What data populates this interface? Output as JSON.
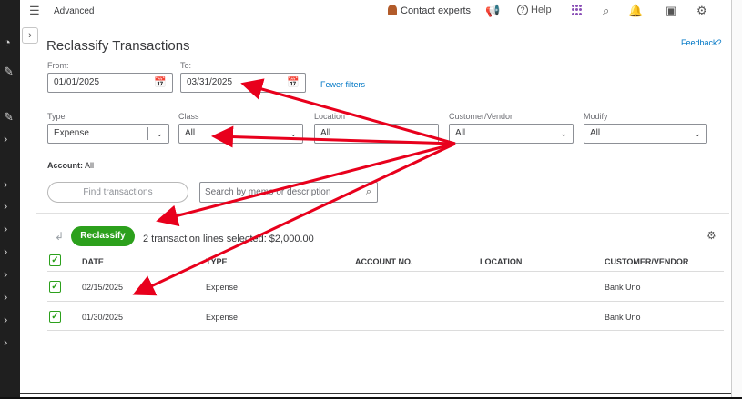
{
  "topbar": {
    "breadcrumb": "Advanced",
    "contact_label": "Contact experts",
    "help_label": "Help"
  },
  "page": {
    "title": "Reclassify Transactions",
    "feedback_label": "Feedback?"
  },
  "filters": {
    "from_label": "From:",
    "from_value": "01/01/2025",
    "to_label": "To:",
    "to_value": "03/31/2025",
    "fewer_filters_label": "Fewer filters",
    "type_label": "Type",
    "type_value": "Expense",
    "class_label": "Class",
    "class_value": "All",
    "location_label": "Location",
    "location_value": "All",
    "customer_label": "Customer/Vendor",
    "customer_value": "All",
    "modify_label": "Modify",
    "modify_value": "All"
  },
  "account": {
    "label": "Account:",
    "value": "All"
  },
  "actions": {
    "find_label": "Find transactions",
    "search_placeholder": "Search by memo or description",
    "reclassify_label": "Reclassify",
    "selected_summary": "2 transaction lines selected: $2,000.00"
  },
  "table": {
    "headers": [
      "DATE",
      "TYPE",
      "ACCOUNT NO.",
      "LOCATION",
      "CUSTOMER/VENDOR"
    ],
    "rows": [
      {
        "date": "02/15/2025",
        "type": "Expense",
        "account_no": "",
        "location": "",
        "customer": "Bank Uno",
        "checked": true
      },
      {
        "date": "01/30/2025",
        "type": "Expense",
        "account_no": "",
        "location": "",
        "customer": "Bank Uno",
        "checked": true
      }
    ]
  },
  "colors": {
    "accent_green": "#2ca01c",
    "link_blue": "#0077c5",
    "annotation_red": "#e8001c"
  }
}
